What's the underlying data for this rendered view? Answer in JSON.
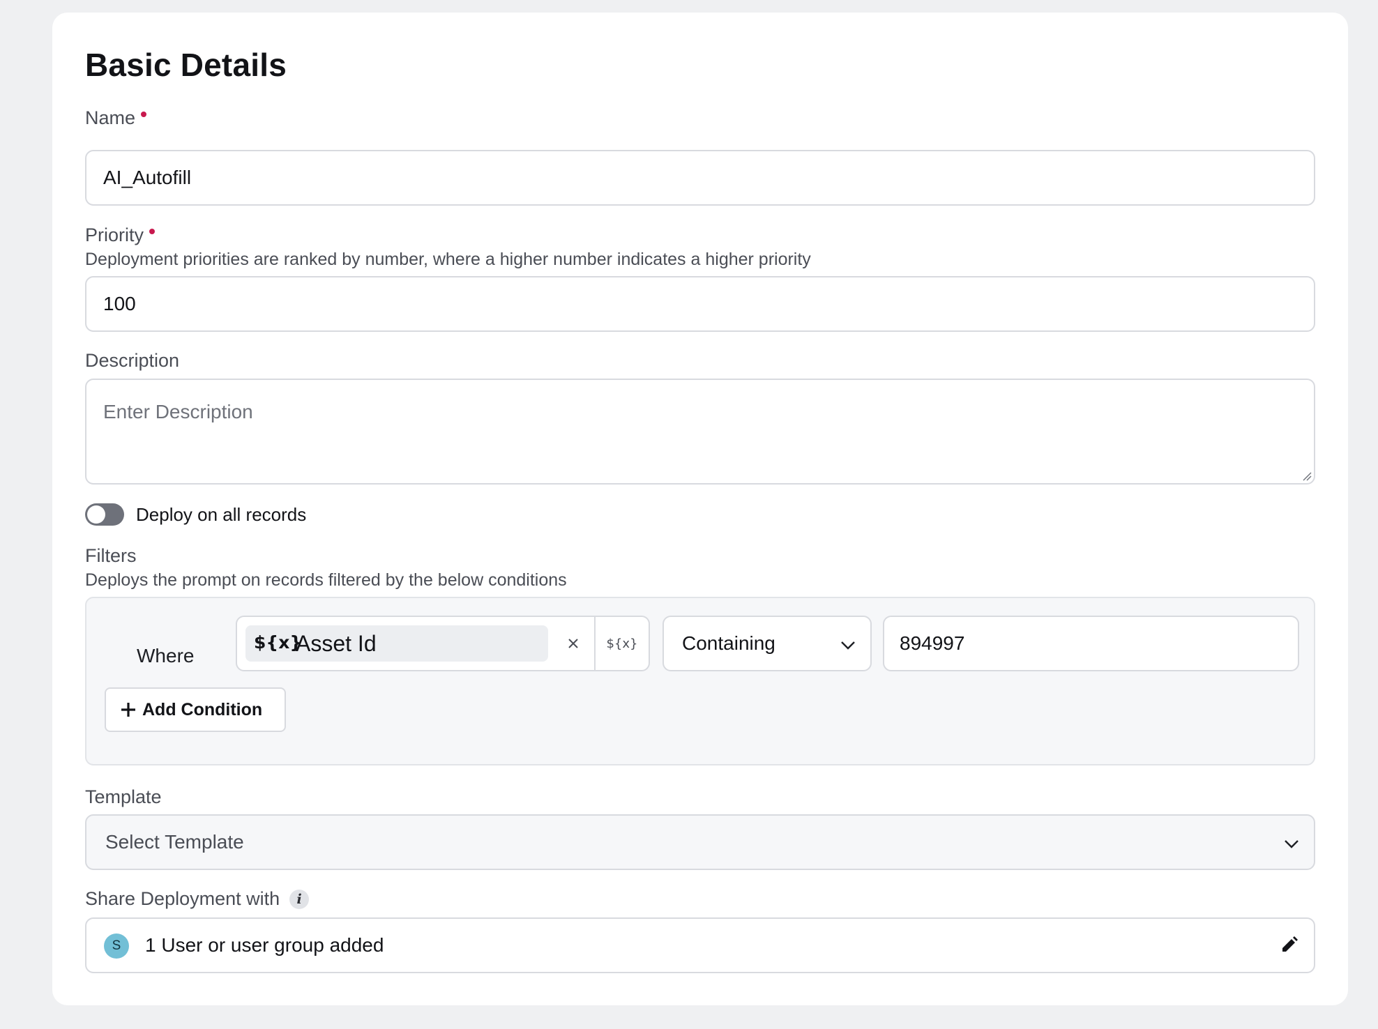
{
  "page": {
    "title": "Basic Details"
  },
  "name_field": {
    "label": "Name",
    "value": "AI_Autofill",
    "required": true
  },
  "priority_field": {
    "label": "Priority",
    "hint": "Deployment priorities are ranked by number, where a higher number indicates a higher priority",
    "value": "100",
    "required": true
  },
  "description_field": {
    "label": "Description",
    "placeholder": "Enter Description",
    "value": ""
  },
  "deploy_toggle": {
    "label": "Deploy on all records",
    "enabled": false
  },
  "filters": {
    "label": "Filters",
    "hint": "Deploys the prompt on records filtered by the below conditions",
    "conditions": [
      {
        "prefix": "Where",
        "variable_icon": "${x}",
        "variable": "Asset Id",
        "clear_icon": "close-icon",
        "variable_button": "${x}",
        "operator": "Containing",
        "value": "894997"
      }
    ],
    "add_condition_label": "Add Condition"
  },
  "template_field": {
    "label": "Template",
    "placeholder": "Select Template"
  },
  "share_field": {
    "label": "Share Deployment with",
    "info_icon": "i",
    "avatar_initial": "S",
    "summary": "1 User or user group added"
  },
  "colors": {
    "required_dot": "#c8194e",
    "avatar_bg": "#72bfd6",
    "toggle_off": "#6e717a",
    "page_bg": "#eff0f2"
  }
}
